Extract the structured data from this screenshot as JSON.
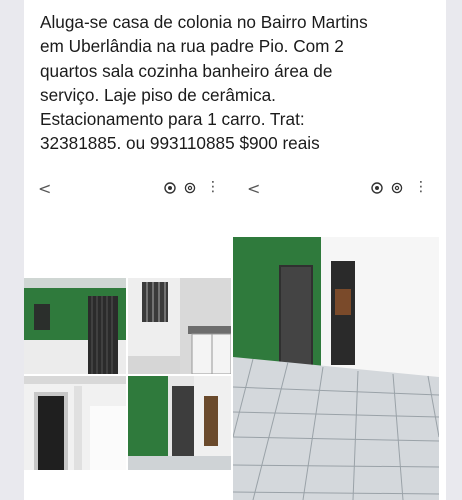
{
  "post": {
    "text": "Aluga-se casa de colonia no Bairro Martins\nem Uberlândia na rua padre Pio. Com 2\nquartos sala cozinha banheiro área de\nserviço. Laje piso de cerâmica.\nEstacionamento para 1 carro. Trat:\n32381885.  ou  993110885  $900  reais"
  },
  "viewer_left": {
    "back_glyph": "<",
    "more_glyph": "⋮",
    "icons": [
      "screen-record-icon",
      "lens-icon",
      "more-vertical-icon"
    ],
    "photos": [
      "green-wall-exterior-photo",
      "window-bars-photo",
      "kitchen-sink-photo",
      "bathroom-door-photo",
      "green-room-doorway-photo"
    ]
  },
  "viewer_right": {
    "back_glyph": "<",
    "more_glyph": "⋮",
    "icons": [
      "screen-record-icon",
      "lens-icon",
      "more-vertical-icon"
    ],
    "photos": [
      "tiled-room-photo"
    ]
  },
  "colors": {
    "wall_green": "#2f7a3c",
    "tile_grey": "#d4d8dc",
    "page_bg": "#e9e9ee"
  }
}
